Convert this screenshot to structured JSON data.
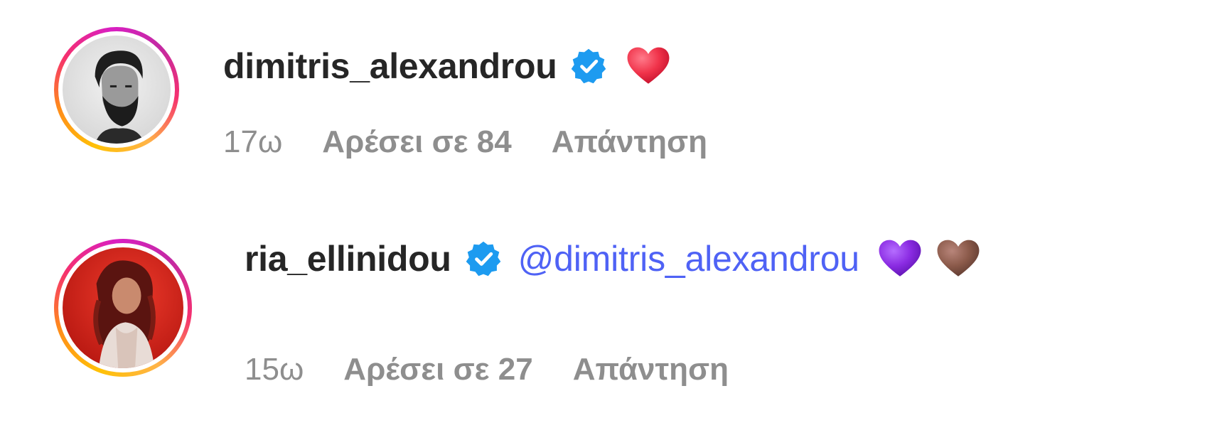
{
  "comments": [
    {
      "username": "dimitris_alexandrou",
      "verified": true,
      "mention": "",
      "emojis": [
        "red-heart"
      ],
      "time": "17ω",
      "likes": "Αρέσει σε 84",
      "reply": "Απάντηση",
      "avatar": "man-bearded-grayscale"
    },
    {
      "username": "ria_ellinidou",
      "verified": true,
      "mention": "@dimitris_alexandrou",
      "emojis": [
        "purple-heart",
        "brown-heart"
      ],
      "time": "15ω",
      "likes": "Αρέσει σε 27",
      "reply": "Απάντηση",
      "avatar": "woman-red-background"
    }
  ],
  "colors": {
    "username": "#262626",
    "meta": "#8e8e8e",
    "mention": "#4f62f5",
    "verified": "#1d9bf0",
    "red_heart": "#f0334a",
    "purple_heart": "#8a2be2",
    "brown_heart": "#8b5a4a"
  }
}
